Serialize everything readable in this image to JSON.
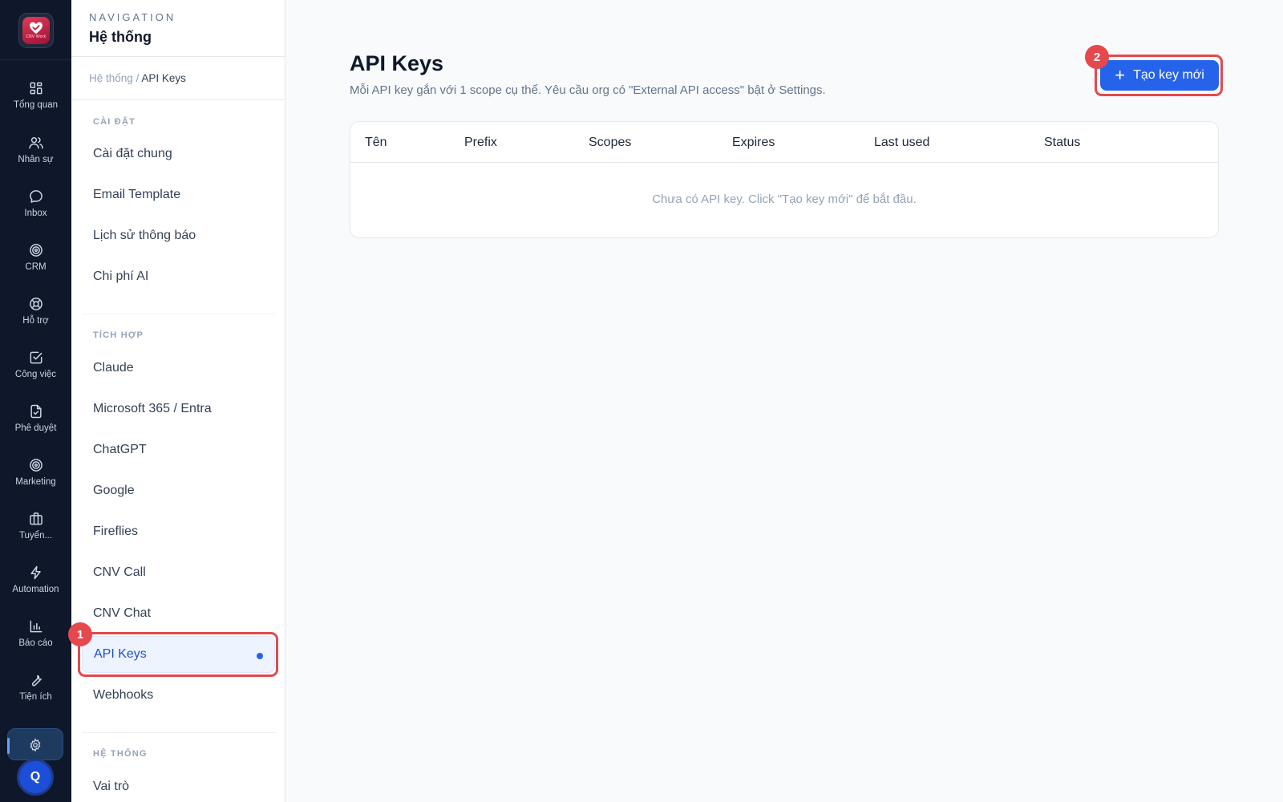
{
  "rail": {
    "logo_text": "CNV Work",
    "items": [
      {
        "label": "Tổng quan",
        "icon": "grid-icon"
      },
      {
        "label": "Nhân sự",
        "icon": "users-icon"
      },
      {
        "label": "Inbox",
        "icon": "chat-bubble-icon"
      },
      {
        "label": "CRM",
        "icon": "target-icon"
      },
      {
        "label": "Hỗ trợ",
        "icon": "lifebuoy-icon"
      },
      {
        "label": "Công việc",
        "icon": "check-square-icon"
      },
      {
        "label": "Phê duyệt",
        "icon": "file-check-icon"
      },
      {
        "label": "Marketing",
        "icon": "target-icon"
      },
      {
        "label": "Tuyển...",
        "icon": "briefcase-icon"
      },
      {
        "label": "Automation",
        "icon": "lightning-icon"
      },
      {
        "label": "Báo cáo",
        "icon": "bar-chart-icon"
      },
      {
        "label": "Tiện ích",
        "icon": "wrench-icon"
      }
    ],
    "active_icon": "gear-icon",
    "avatar_initial": "Q"
  },
  "subnav": {
    "eyebrow": "NAVIGATION",
    "title": "Hệ thống",
    "breadcrumb": {
      "parent": "Hệ thống",
      "separator": "/",
      "current": "API Keys"
    },
    "sections": [
      {
        "heading": "CÀI ĐẶT",
        "items": [
          "Cài đặt chung",
          "Email Template",
          "Lịch sử thông báo",
          "Chi phí AI"
        ]
      },
      {
        "heading": "TÍCH HỢP",
        "items": [
          "Claude",
          "Microsoft 365 / Entra",
          "ChatGPT",
          "Google",
          "Fireflies",
          "CNV Call",
          "CNV Chat",
          "API Keys",
          "Webhooks"
        ]
      },
      {
        "heading": "HỆ THỐNG",
        "items": [
          "Vai trò"
        ]
      }
    ],
    "active_item": "API Keys"
  },
  "annotations": {
    "badge_1": "1",
    "badge_2": "2",
    "highlight_color": "#e5484d"
  },
  "main": {
    "title": "API Keys",
    "subtitle": "Mỗi API key gắn với 1 scope cụ thể. Yêu cầu org có \"External API access\" bật ở Settings.",
    "create_button": {
      "icon": "+",
      "label": "Tạo key mới"
    },
    "table": {
      "columns": [
        "Tên",
        "Prefix",
        "Scopes",
        "Expires",
        "Last used",
        "Status"
      ],
      "rows": [],
      "empty_text": "Chưa có API key. Click \"Tạo key mới\" để bắt đầu."
    }
  },
  "colors": {
    "accent": "#2563eb",
    "rail_bg": "#0f172a",
    "page_bg": "#f8fafc"
  }
}
